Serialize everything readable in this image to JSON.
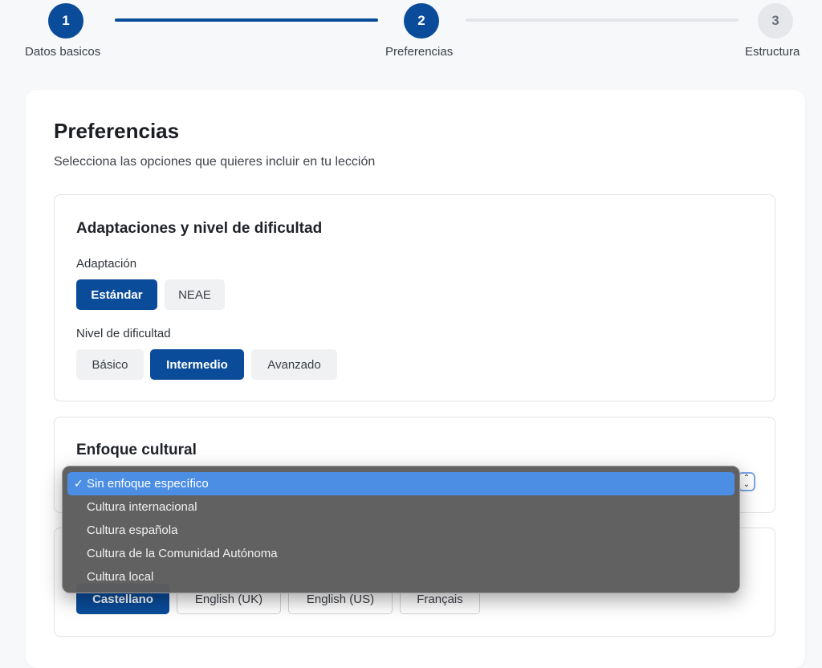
{
  "stepper": {
    "steps": [
      {
        "number": "1",
        "label": "Datos basicos"
      },
      {
        "number": "2",
        "label": "Preferencias"
      },
      {
        "number": "3",
        "label": "Estructura"
      }
    ]
  },
  "page": {
    "title": "Preferencias",
    "subtitle": "Selecciona las opciones que quieres incluir en tu lección"
  },
  "adaptations": {
    "title": "Adaptaciones y nivel de dificultad",
    "adaptation_label": "Adaptación",
    "adaptation_options": [
      "Estándar",
      "NEAE"
    ],
    "adaptation_selected": "Estándar",
    "difficulty_label": "Nivel de dificultad",
    "difficulty_options": [
      "Básico",
      "Intermedio",
      "Avanzado"
    ],
    "difficulty_selected": "Intermedio"
  },
  "cultural": {
    "title": "Enfoque cultural",
    "dropdown_options": [
      "Sin enfoque específico",
      "Cultura internacional",
      "Cultura española",
      "Cultura de la Comunidad Autónoma",
      "Cultura local"
    ],
    "selected_index": 0,
    "check_glyph": "✓"
  },
  "language": {
    "options": [
      "Castellano",
      "English (UK)",
      "English (US)",
      "Français"
    ],
    "selected": "Castellano"
  },
  "colors": {
    "primary": "#0a4c9a",
    "highlight": "#4b8ee3",
    "background": "#f6f8fa"
  }
}
